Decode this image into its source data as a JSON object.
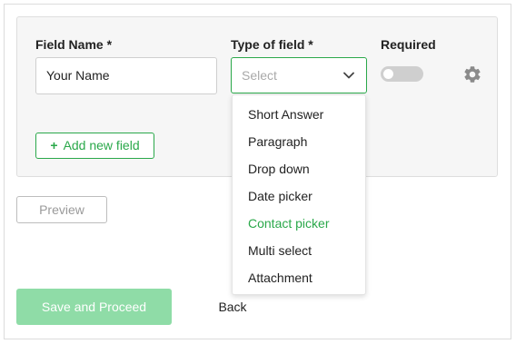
{
  "form": {
    "field_name_label": "Field Name *",
    "field_name_value": "Your Name",
    "type_label": "Type of field *",
    "type_placeholder": "Select",
    "required_label": "Required",
    "required_on": false,
    "add_field_label": "Add new field"
  },
  "dropdown": {
    "options": [
      "Short Answer",
      "Paragraph",
      "Drop down",
      "Date picker",
      "Contact picker",
      "Multi select",
      "Attachment"
    ],
    "highlighted": "Contact picker"
  },
  "actions": {
    "preview_label": "Preview",
    "save_label": "Save and Proceed",
    "back_label": "Back"
  },
  "colors": {
    "accent": "#2aa84a",
    "save_disabled": "#8fdca7",
    "toggle_off": "#cfcfcf"
  },
  "icons": {
    "chevron": "chevron-down-icon",
    "settings": "gear-icon",
    "add": "plus-icon"
  }
}
